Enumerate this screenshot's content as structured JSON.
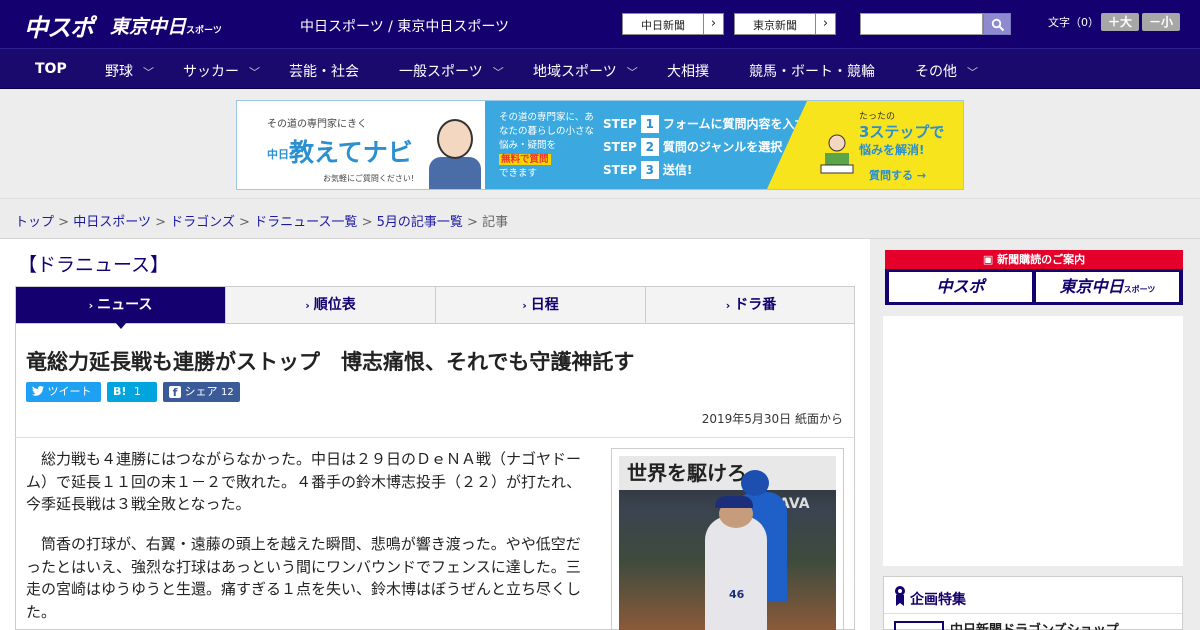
{
  "header": {
    "logo_chuspo": "中スポ",
    "logo_tokyo": "東京中日",
    "logo_tokyo_small": "スポーツ",
    "site_title": "中日スポーツ / 東京中日スポーツ",
    "links": [
      {
        "label": "中日新聞"
      },
      {
        "label": "東京新聞"
      }
    ],
    "search_placeholder": "",
    "font_size_label": "文字（0）",
    "font_larger": "＋大",
    "font_smaller": "－小"
  },
  "nav": [
    {
      "label": "TOP",
      "has_menu": false
    },
    {
      "label": "野球",
      "has_menu": true
    },
    {
      "label": "サッカー",
      "has_menu": true
    },
    {
      "label": "芸能・社会",
      "has_menu": false
    },
    {
      "label": "一般スポーツ",
      "has_menu": true
    },
    {
      "label": "地域スポーツ",
      "has_menu": true
    },
    {
      "label": "大相撲",
      "has_menu": false
    },
    {
      "label": "競馬・ボート・競輪",
      "has_menu": false
    },
    {
      "label": "その他",
      "has_menu": true
    }
  ],
  "banner_ad": {
    "tagline": "その道の専門家にきく",
    "brand_prefix": "中日",
    "brand": "教えてナビ",
    "note": "お気軽にご質問ください!",
    "intro": "その道の専門家に、あなたの暮らしの小さな悩み・疑問を",
    "free_label": "無料で質問",
    "intro_end": "できます",
    "steps": [
      {
        "label": "STEP",
        "num": "1",
        "text": "フォームに質問内容を入力"
      },
      {
        "label": "STEP",
        "num": "2",
        "text": "質問のジャンルを選択"
      },
      {
        "label": "STEP",
        "num": "3",
        "text": "送信!"
      }
    ],
    "right_small": "たったの",
    "right_big": "3ステップで",
    "right_sub": "悩みを解消!",
    "cta": "質問する →"
  },
  "breadcrumb": {
    "items": [
      "トップ",
      "中日スポーツ",
      "ドラゴンズ",
      "ドラニュース一覧",
      "5月の記事一覧"
    ],
    "current": "記事",
    "separator": ">"
  },
  "section_title": "【ドラニュース】",
  "tabs": [
    {
      "label": "ニュース",
      "active": true
    },
    {
      "label": "順位表",
      "active": false
    },
    {
      "label": "日程",
      "active": false
    },
    {
      "label": "ドラ番",
      "active": false
    }
  ],
  "article": {
    "title": "竜総力延長戦も連勝がストップ　博志痛恨、それでも守護神託す",
    "share": {
      "tweet": "ツイート",
      "hatena": "B!",
      "hatena_count": "1",
      "facebook": "シェア",
      "facebook_count": "12"
    },
    "date": "2019年5月30日 紙面から",
    "paragraphs": [
      "総力戦も４連勝にはつながらなかった。中日は２９日のＤｅＮＡ戦（ナゴヤドーム）で延長１１回の末１－２で敗れた。４番手の鈴木博志投手（２２）が打たれ、今季延長戦は３戦全敗となった。",
      "筒香の打球が、右翼・遠藤の頭上を越えた瞬間、悲鳴が響き渡った。やや低空だったとはいえ、強烈な打球はあっという間にワンバウンドでフェンスに達した。三走の宮崎はゆうゆうと生還。痛すぎる１点を失い、鈴木博はぼうぜんと立ち尽くした。"
    ],
    "photo_billboard": "世界を駆けろ。",
    "photo_board_text": "AVA",
    "photo_jersey_number": "46"
  },
  "sidebar": {
    "subscription_title": "新聞購読のご案内",
    "subscription_left": "中スポ",
    "subscription_right": "東京中日",
    "subscription_right_small": "スポーツ",
    "feature_title": "企画特集",
    "feature_item": "中日新聞ドラゴンズショップ"
  },
  "colors": {
    "primary": "#15006f",
    "accent_red": "#e4002b",
    "twitter": "#1ea1f2",
    "hatena": "#00a4de",
    "facebook": "#3b5b98"
  }
}
